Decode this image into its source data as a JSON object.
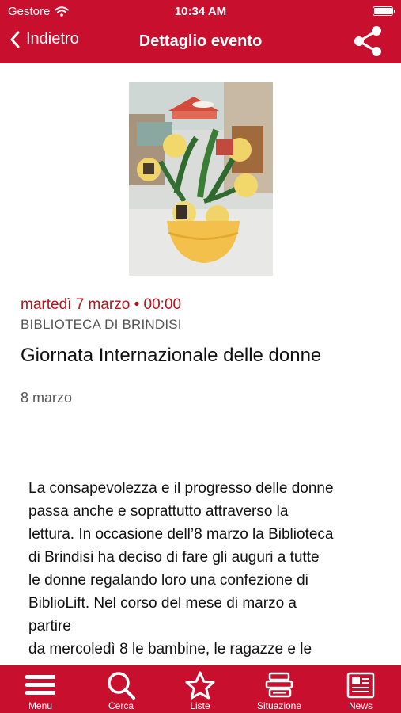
{
  "status": {
    "carrier": "Gestore",
    "time": "10:34 AM"
  },
  "nav": {
    "back_label": "Indietro",
    "title": "Dettaglio evento"
  },
  "event": {
    "date": "martedì 7 marzo • 00:00",
    "venue": "BIBLIOTECA DI BRINDISI",
    "title": "Giornata Internazionale delle donne",
    "subtitle": "8 marzo",
    "body": [
      "La consapevolezza e il progresso delle donne",
      "passa anche e soprattutto attraverso la",
      "lettura. In occasione dell’8 marzo la Biblioteca",
      "di Brindisi ha deciso di fare gli auguri a tutte",
      "le donne regalando loro una confezione di",
      "BiblioLift. Nel corso del mese di marzo a",
      "partire",
      "da mercoledì 8 le bambine, le ragazze e le"
    ]
  },
  "tabs": [
    {
      "label": "Menu",
      "icon": "menu-icon"
    },
    {
      "label": "Cerca",
      "icon": "search-icon"
    },
    {
      "label": "Liste",
      "icon": "star-icon"
    },
    {
      "label": "Situazione",
      "icon": "books-stack-icon"
    },
    {
      "label": "News",
      "icon": "newspaper-icon"
    }
  ],
  "colors": {
    "brand": "#c8102e",
    "date": "#b5121b"
  }
}
